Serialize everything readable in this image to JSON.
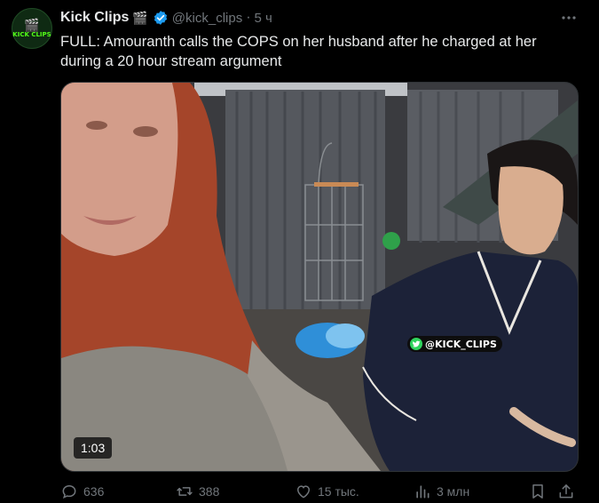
{
  "tweet": {
    "author_name": "Kick Clips",
    "author_emoji": "🎬",
    "handle": "@kick_clips",
    "separator": "·",
    "time": "5 ч",
    "text": "FULL: Amouranth calls the COPS on her husband after he charged at her during a 20 hour stream argument",
    "avatar_text": "KICK CLIPS",
    "avatar_emoji": "🎬"
  },
  "media": {
    "duration": "1:03",
    "watermark": "@KICK_CLIPS"
  },
  "actions": {
    "replies": "636",
    "reposts": "388",
    "likes": "15 тыс.",
    "views": "3 млн"
  },
  "colors": {
    "verified": "#1d9bf0",
    "muted": "#71767b",
    "text": "#e7e9ea",
    "background": "#000000"
  }
}
